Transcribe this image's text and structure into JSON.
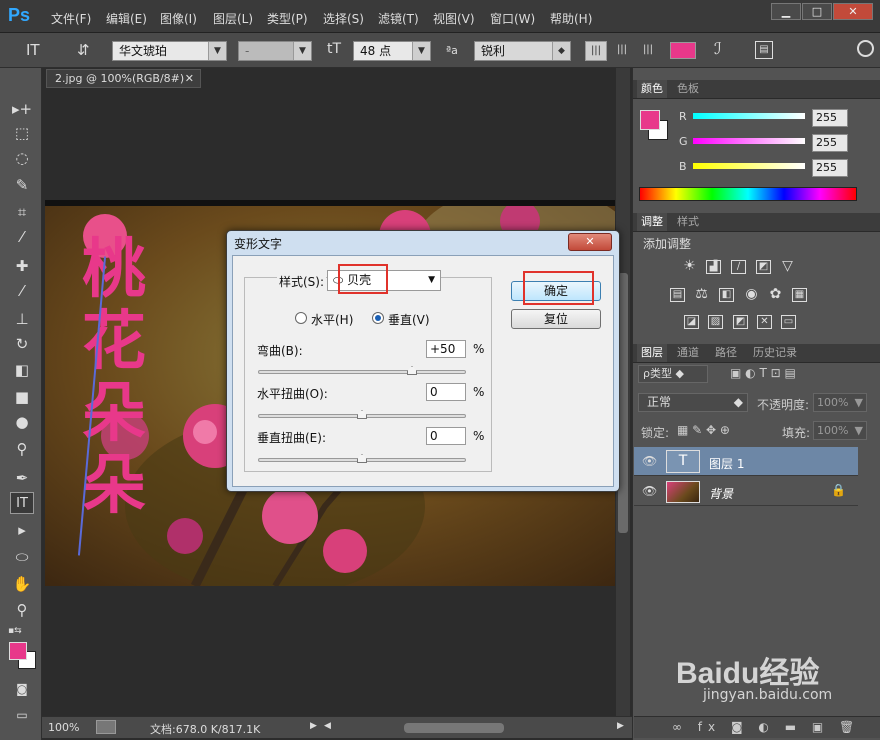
{
  "app": {
    "logo": "Ps"
  },
  "menu": [
    "文件(F)",
    "编辑(E)",
    "图像(I)",
    "图层(L)",
    "类型(P)",
    "选择(S)",
    "滤镜(T)",
    "视图(V)",
    "窗口(W)",
    "帮助(H)"
  ],
  "options": {
    "font_family": "华文琥珀",
    "font_style": "-",
    "font_size": "48 点",
    "aa_label": "ªa",
    "antialias": "锐利",
    "text_color": "#e8388a"
  },
  "document": {
    "tab_title": "2.jpg @ 100%(RGB/8#)",
    "vertical_text": [
      "桃",
      "花",
      "朵",
      "朵"
    ],
    "zoom": "100%",
    "doc_info": "文档:678.0 K/817.1K"
  },
  "color_panel": {
    "tabs": [
      "颜色",
      "色板"
    ],
    "channels": [
      {
        "label": "R",
        "value": "255"
      },
      {
        "label": "G",
        "value": "255"
      },
      {
        "label": "B",
        "value": "255"
      }
    ],
    "foreground": "#e8388a",
    "background": "#ffffff"
  },
  "adjust_panel": {
    "tabs": [
      "调整",
      "样式"
    ],
    "add_label": "添加调整"
  },
  "layers_panel": {
    "tabs": [
      "图层",
      "通道",
      "路径",
      "历史记录"
    ],
    "filter_label": "ρ类型",
    "blend_mode": "正常",
    "opacity_label": "不透明度:",
    "opacity_value": "100%",
    "lock_label": "锁定:",
    "fill_label": "填充:",
    "fill_value": "100%",
    "layers": [
      {
        "name": "图层 1",
        "type": "text",
        "thumb": "T",
        "selected": true
      },
      {
        "name": "背景",
        "type": "image",
        "locked": true,
        "selected": false
      }
    ]
  },
  "warp_dialog": {
    "title": "变形文字",
    "style_label": "样式(S):",
    "style_value": "贝壳",
    "style_icon": "⬭",
    "horizontal_label": "水平(H)",
    "vertical_label": "垂直(V)",
    "orientation": "vertical",
    "bend_label": "弯曲(B):",
    "bend_value": "+50",
    "hdist_label": "水平扭曲(O):",
    "hdist_value": "0",
    "vdist_label": "垂直扭曲(E):",
    "vdist_value": "0",
    "percent": "%",
    "ok_label": "确定",
    "reset_label": "复位",
    "close_label": "✕"
  },
  "watermark": {
    "brand": "Baidu经验",
    "url": "jingyan.baidu.com"
  }
}
